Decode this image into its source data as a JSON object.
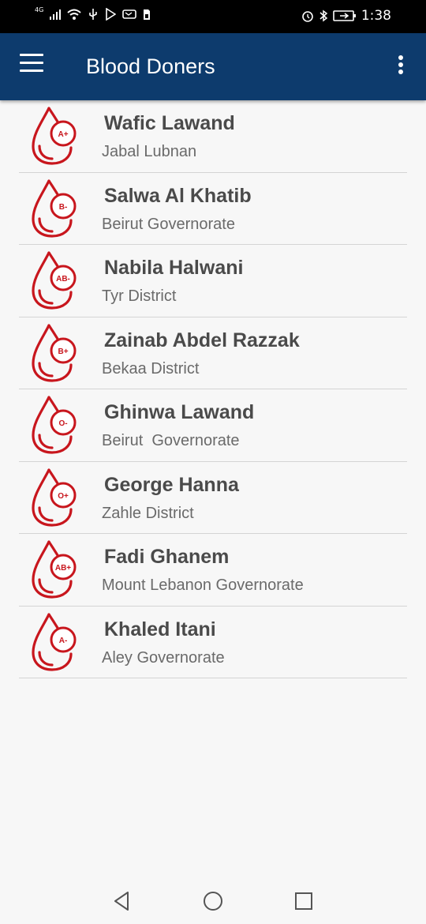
{
  "status_bar": {
    "network_label": "4G",
    "time": "1:38",
    "icons": [
      "signal-icon",
      "wifi-icon",
      "usb-icon",
      "play-store-icon",
      "messenger-icon",
      "sim-icon",
      "alarm-icon",
      "bluetooth-icon",
      "battery-icon"
    ]
  },
  "app_bar": {
    "title": "Blood Doners",
    "menu_icon": "hamburger-menu-icon",
    "overflow_icon": "more-vert-icon"
  },
  "colors": {
    "app_bar": "#0d3b6d",
    "drop": "#c8161d",
    "name": "#4a4a4a",
    "region": "#6a6a6a"
  },
  "donors": [
    {
      "name": "Wafic Lawand",
      "region": "Jabal Lubnan",
      "blood_type": "A+"
    },
    {
      "name": "Salwa Al Khatib",
      "region": "Beirut Governorate",
      "blood_type": "B-"
    },
    {
      "name": "Nabila Halwani",
      "region": "Tyr District",
      "blood_type": "AB-"
    },
    {
      "name": "Zainab Abdel Razzak",
      "region": "Bekaa District",
      "blood_type": "B+"
    },
    {
      "name": "Ghinwa Lawand",
      "region": "Beirut  Governorate",
      "blood_type": "O-"
    },
    {
      "name": "George Hanna",
      "region": "Zahle District",
      "blood_type": "O+"
    },
    {
      "name": "Fadi Ghanem",
      "region": "Mount Lebanon Governorate",
      "blood_type": "AB+"
    },
    {
      "name": "Khaled Itani",
      "region": "Aley Governorate",
      "blood_type": "A-"
    }
  ],
  "nav_bar": {
    "icons": [
      "back-icon",
      "home-icon",
      "recents-icon"
    ]
  }
}
